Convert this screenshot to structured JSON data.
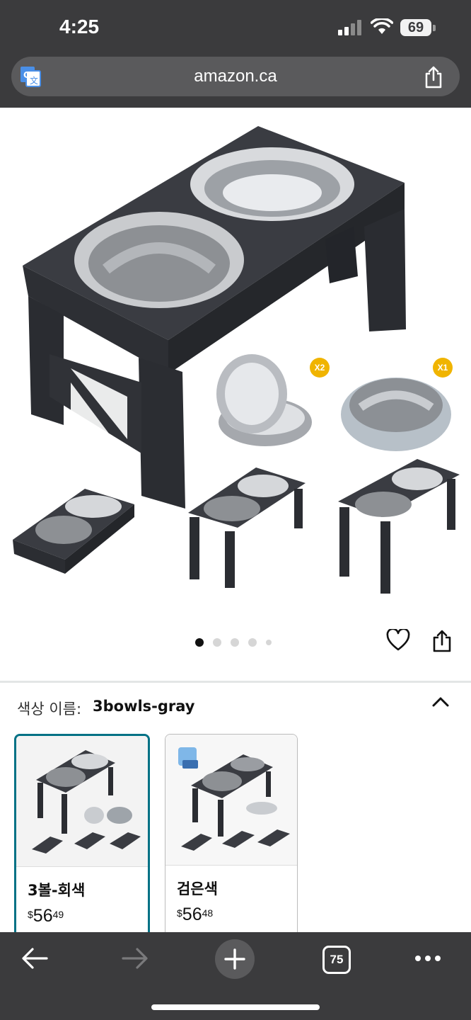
{
  "status_bar": {
    "time": "4:25",
    "battery": "69"
  },
  "browser": {
    "url": "amazon.ca"
  },
  "gallery": {
    "badges": {
      "bowl_pair": "X2",
      "slow_feeder": "X1"
    },
    "dots_count": 5,
    "active_dot": 0
  },
  "variation": {
    "label": "색상 이름:",
    "selected_value": "3bowls-gray",
    "options": [
      {
        "name": "3볼-회색",
        "price_currency": "$",
        "price_whole": "56",
        "price_fraction": "49",
        "selected": true
      },
      {
        "name": "검은색",
        "price_currency": "$",
        "price_whole": "56",
        "price_fraction": "48",
        "selected": false
      }
    ]
  },
  "toolbar": {
    "tab_count": "75"
  },
  "colors": {
    "chrome": "#3b3b3d",
    "selected_border": "#007185",
    "badge": "#f0b400"
  }
}
